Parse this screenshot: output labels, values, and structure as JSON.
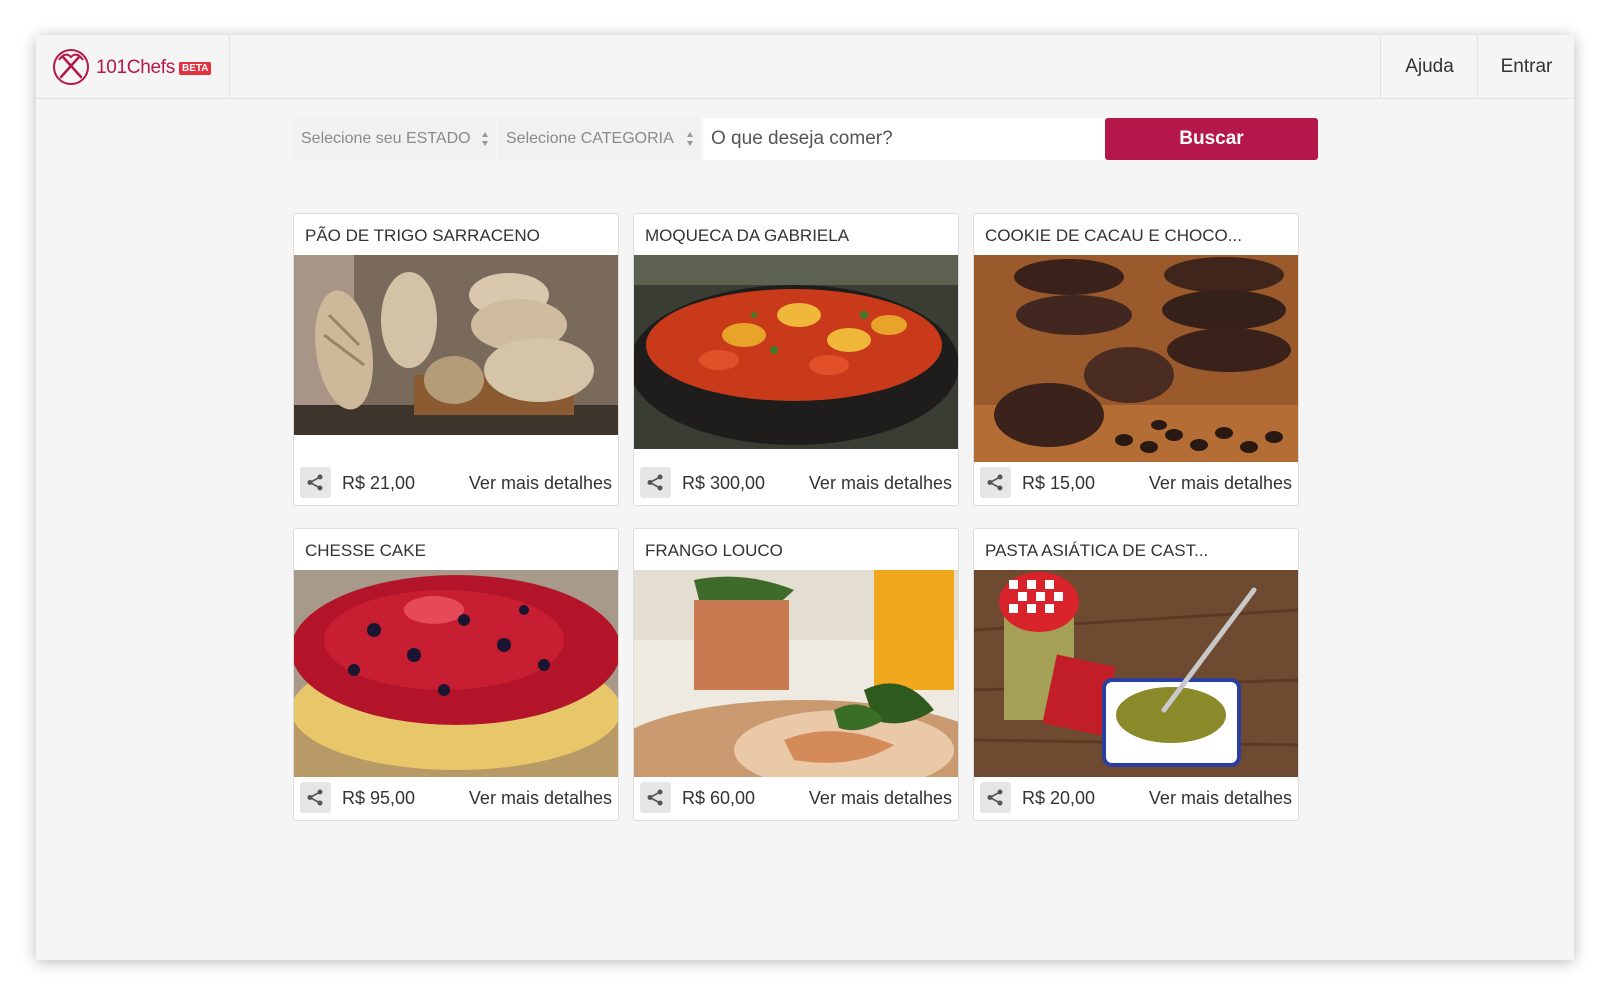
{
  "header": {
    "logo_text": "101Chefs",
    "beta_badge": "BETA",
    "nav": [
      {
        "label": "Ajuda"
      },
      {
        "label": "Entrar"
      }
    ]
  },
  "search": {
    "state_select": "Selecione seu ESTADO",
    "category_select": "Selecione CATEGORIA",
    "query_placeholder": "O que deseja comer?",
    "query_value": "",
    "button_label": "Buscar"
  },
  "colors": {
    "accent": "#b5174a",
    "beta": "#e3313e",
    "background": "#f5f5f5"
  },
  "cards": [
    {
      "title": "PÃO DE TRIGO SARRACENO",
      "price": "R$ 21,00",
      "details": "Ver mais detalhes",
      "image": "bread"
    },
    {
      "title": "MOQUECA DA GABRIELA",
      "price": "R$ 300,00",
      "details": "Ver mais detalhes",
      "image": "moqueca"
    },
    {
      "title": "COOKIE DE CACAU E CHOCO...",
      "price": "R$ 15,00",
      "details": "Ver mais detalhes",
      "image": "cookies"
    },
    {
      "title": "CHESSE CAKE",
      "price": "R$ 95,00",
      "details": "Ver mais detalhes",
      "image": "cheesecake"
    },
    {
      "title": "FRANGO LOUCO",
      "price": "R$ 60,00",
      "details": "Ver mais detalhes",
      "image": "chicken"
    },
    {
      "title": "PASTA ASIÁTICA DE CAST...",
      "price": "R$ 20,00",
      "details": "Ver mais detalhes",
      "image": "pasta-jar"
    }
  ],
  "icons": {
    "logo": "chef-utensils-icon",
    "share": "share-icon",
    "select_arrows": "sort-arrows-icon"
  }
}
